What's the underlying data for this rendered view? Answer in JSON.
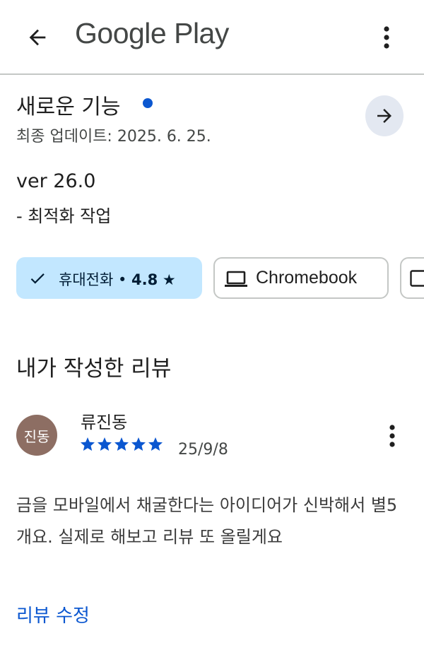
{
  "app_bar": {
    "title": "Google Play",
    "back_icon": "arrow-back-icon",
    "more_icon": "more-vert-icon"
  },
  "whats_new": {
    "title": "새로운 기능",
    "last_updated": "최종 업데이트: 2025. 6. 25.",
    "version": "ver 26.0",
    "changes": "- 최적화 작업",
    "arrow_icon": "arrow-forward-icon"
  },
  "device_chips": [
    {
      "label": "휴대전화",
      "rating": "4.8",
      "selected": true,
      "icon": "check-icon"
    },
    {
      "label": "Chromebook",
      "selected": false,
      "icon": "laptop-icon"
    },
    {
      "label": "",
      "selected": false,
      "icon": "tablet-icon"
    }
  ],
  "my_review": {
    "section_title": "내가 작성한 리뷰",
    "avatar_initials": "진동",
    "reviewer_name": "류진동",
    "rating": 5,
    "date": "25/9/8",
    "body": "금을 모바일에서 채굴한다는 아이디어가 신박해서 별5개요. 실제로 해보고 리뷰 또 올릴게요",
    "edit_label": "리뷰 수정"
  },
  "colors": {
    "accent": "#0b57d0",
    "chip_selected": "#c2e7ff",
    "avatar": "#8d6e63",
    "divider": "#c4c7c5"
  }
}
